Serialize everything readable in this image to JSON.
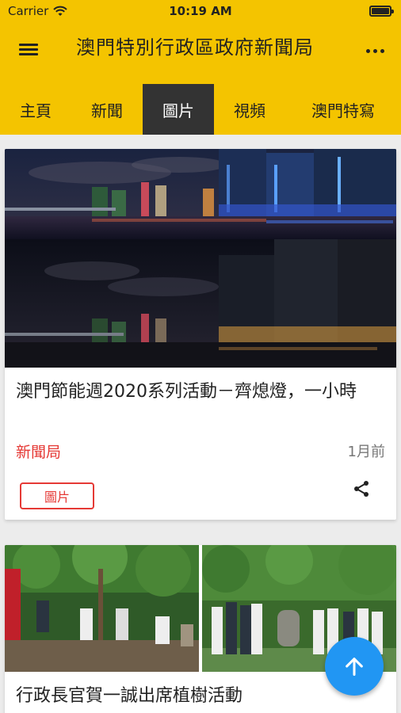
{
  "status": {
    "carrier": "Carrier",
    "time": "10:19 AM"
  },
  "header": {
    "title": "澳門特別行政區政府新聞局"
  },
  "tabs": [
    {
      "label": "主頁"
    },
    {
      "label": "新聞"
    },
    {
      "label": "圖片",
      "active": true
    },
    {
      "label": "視頻"
    },
    {
      "label": "澳門特寫"
    }
  ],
  "cards": [
    {
      "title": "澳門節能週2020系列活動－齊熄燈，一小時",
      "source": "新聞局",
      "time_ago": "1月前",
      "category": "圖片"
    },
    {
      "title": "行政長官賀一誠出席植樹活動"
    }
  ],
  "colors": {
    "brand": "#f4c400",
    "accent": "#e53935",
    "fab": "#2196f3",
    "active_tab": "#333333"
  }
}
